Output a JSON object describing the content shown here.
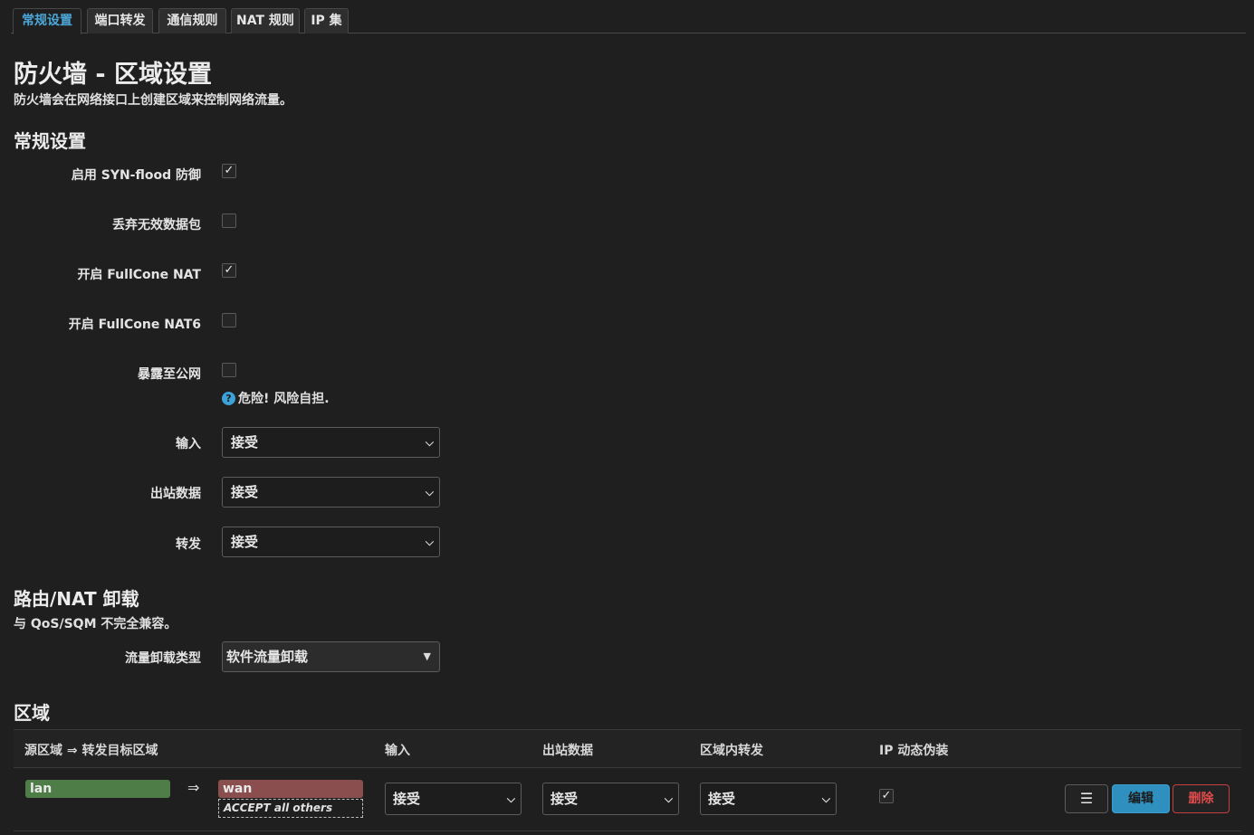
{
  "tabs": [
    {
      "label": "常规设置",
      "active": true
    },
    {
      "label": "端口转发",
      "active": false
    },
    {
      "label": "通信规则",
      "active": false
    },
    {
      "label": "NAT 规则",
      "active": false
    },
    {
      "label": "IP 集",
      "active": false
    }
  ],
  "page": {
    "title": "防火墙 - 区域设置",
    "description": "防火墙会在网络接口上创建区域来控制网络流量。"
  },
  "general": {
    "heading": "常规设置",
    "syn_flood": {
      "label": "启用 SYN-flood 防御",
      "checked": true,
      "mark": "✓"
    },
    "drop_invalid": {
      "label": "丢弃无效数据包",
      "checked": false,
      "mark": ""
    },
    "fullcone_nat": {
      "label": "开启 FullCone NAT",
      "checked": true,
      "mark": "✓"
    },
    "fullcone_nat6": {
      "label": "开启 FullCone NAT6",
      "checked": false,
      "mark": ""
    },
    "expose_wan": {
      "label": "暴露至公网",
      "checked": false,
      "mark": ""
    },
    "expose_hint_icon": "?",
    "expose_hint": "危险! 风险自担.",
    "input": {
      "label": "输入",
      "value": "接受"
    },
    "output": {
      "label": "出站数据",
      "value": "接受"
    },
    "forward": {
      "label": "转发",
      "value": "接受"
    }
  },
  "offload": {
    "heading": "路由/NAT 卸载",
    "description": "与 QoS/SQM 不完全兼容。",
    "type": {
      "label": "流量卸载类型",
      "value": "软件流量卸载"
    }
  },
  "zones": {
    "heading": "区域",
    "columns": [
      "源区域 ⇒ 转发目标区域",
      "输入",
      "出站数据",
      "区域内转发",
      "IP 动态伪装"
    ],
    "rows": [
      {
        "source": "lan",
        "arrow": "⇒",
        "dest": "wan",
        "dest_sub": "ACCEPT all others",
        "input": "接受",
        "output": "接受",
        "forward": "接受",
        "masq": true,
        "masq_mark": "✓",
        "menu_icon": "☰",
        "edit_label": "编辑",
        "delete_label": "删除"
      }
    ]
  },
  "colors": {
    "accent": "#4ca7d8",
    "lan": "#4f7d47",
    "wan": "#8a4e4e",
    "delete": "#e14b4b"
  }
}
